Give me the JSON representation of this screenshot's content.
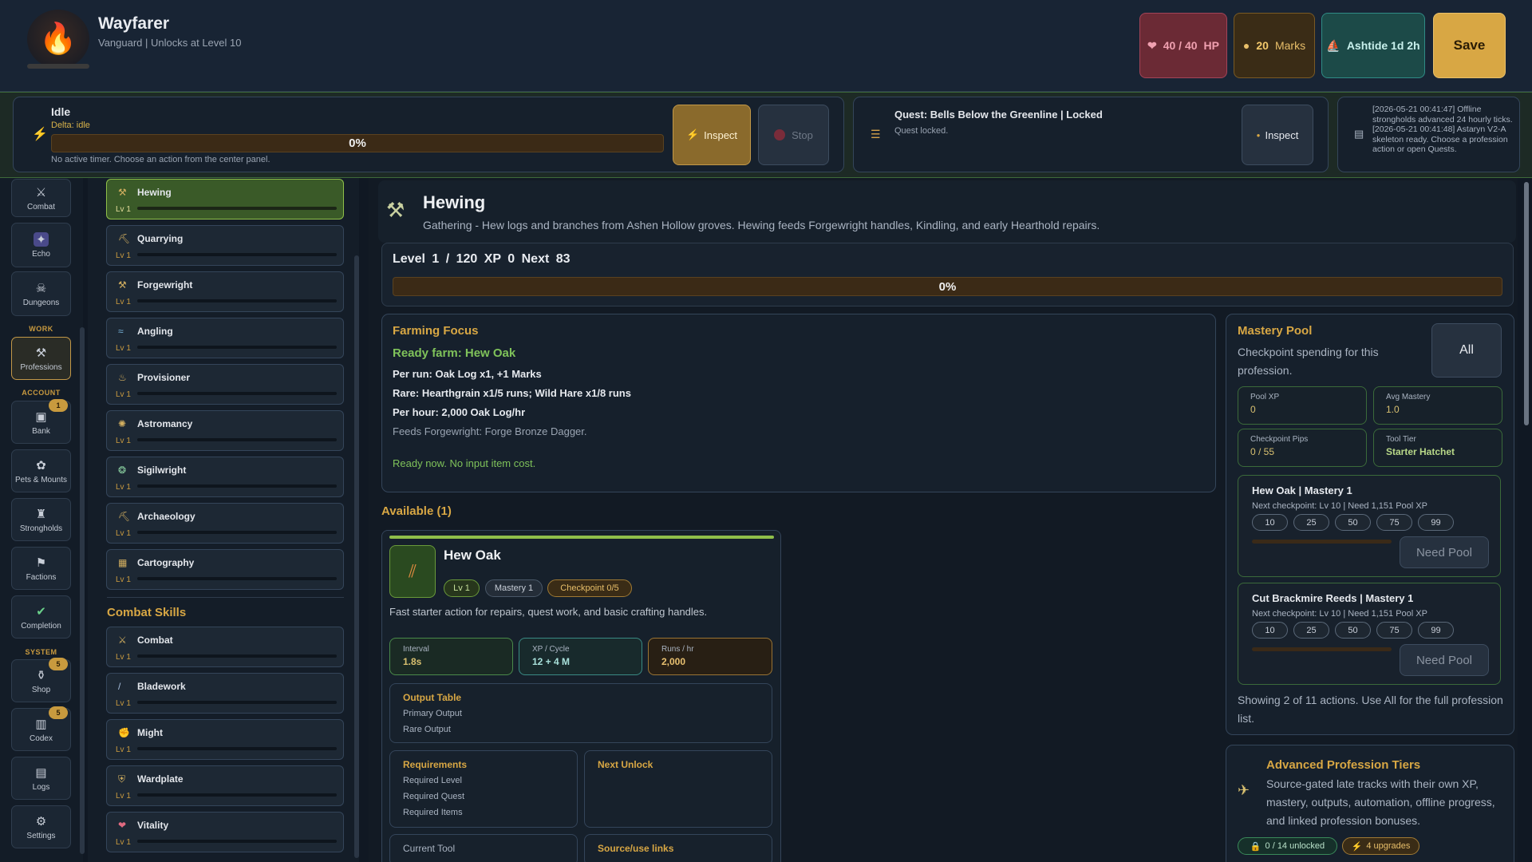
{
  "app": {
    "title": "Wayfarer",
    "subtitle": "Vanguard | Unlocks at Level 10",
    "logo_icon": "flame-icon"
  },
  "stats": {
    "hp_label": "40 / 40",
    "hp_suffix": "HP",
    "marks_value": "20",
    "marks_label": "Marks",
    "ashtide_label": "Ashtide 1d 2h"
  },
  "save_label": "Save",
  "activity": {
    "title": "Idle",
    "delta": "Delta: idle",
    "progress_label": "0%",
    "progress": 0,
    "note": "No active timer. Choose an action from the center panel.",
    "inspect_label": "Inspect",
    "stop_label": "Stop"
  },
  "quest": {
    "title": "Quest: Bells Below the Greenline | Locked",
    "status": "Quest locked.",
    "inspect_label": "Inspect"
  },
  "log": {
    "entries": [
      "[2026-05-21 00:41:47] Offline strongholds advanced 24 hourly ticks.",
      "[2026-05-21 00:41:48] Astaryn V2-A skeleton ready. Choose a profession action or open Quests."
    ]
  },
  "nav": {
    "sections": {
      "work": "WORK",
      "account": "ACCOUNT",
      "system": "SYSTEM"
    },
    "items": [
      {
        "label": "Combat",
        "icon": "crossed-swords-icon"
      },
      {
        "label": "Echo",
        "icon": "sparkle-icon"
      },
      {
        "label": "Dungeons",
        "icon": "skull-icon"
      },
      {
        "label": "Professions",
        "icon": "pickaxe-icon"
      },
      {
        "label": "Bank",
        "icon": "chest-icon",
        "badge": "1"
      },
      {
        "label": "Pets & Mounts",
        "icon": "paw-icon"
      },
      {
        "label": "Strongholds",
        "icon": "castle-icon"
      },
      {
        "label": "Factions",
        "icon": "flag-icon"
      },
      {
        "label": "Completion",
        "icon": "check-circle-icon"
      },
      {
        "label": "Shop",
        "icon": "bag-icon",
        "badge": "5"
      },
      {
        "label": "Codex",
        "icon": "book-icon",
        "badge": "5"
      },
      {
        "label": "Logs",
        "icon": "scroll-icon"
      },
      {
        "label": "Settings",
        "icon": "gear-icon"
      }
    ]
  },
  "skills": {
    "gathering": [
      {
        "name": "Hewing",
        "level": "Lv 1",
        "icon": "hatchet-icon"
      },
      {
        "name": "Quarrying",
        "level": "Lv 1",
        "icon": "pickaxe-icon"
      },
      {
        "name": "Forgewright",
        "level": "Lv 1",
        "icon": "hammer-icon"
      },
      {
        "name": "Angling",
        "level": "Lv 1",
        "icon": "fish-icon"
      },
      {
        "name": "Provisioner",
        "level": "Lv 1",
        "icon": "cooking-icon"
      },
      {
        "name": "Astromancy",
        "level": "Lv 1",
        "icon": "star-icon"
      },
      {
        "name": "Sigilwright",
        "level": "Lv 1",
        "icon": "rune-icon"
      },
      {
        "name": "Archaeology",
        "level": "Lv 1",
        "icon": "shovel-icon"
      },
      {
        "name": "Cartography",
        "level": "Lv 1",
        "icon": "map-icon"
      }
    ],
    "combat_title": "Combat Skills",
    "combat": [
      {
        "name": "Combat",
        "level": "Lv 1",
        "icon": "crossed-swords-icon"
      },
      {
        "name": "Bladework",
        "level": "Lv 1",
        "icon": "sword-icon"
      },
      {
        "name": "Might",
        "level": "Lv 1",
        "icon": "fist-icon"
      },
      {
        "name": "Wardplate",
        "level": "Lv 1",
        "icon": "shield-icon"
      },
      {
        "name": "Vitality",
        "level": "Lv 1",
        "icon": "heart-icon"
      }
    ]
  },
  "profession": {
    "name": "Hewing",
    "icon": "hatchet-icon",
    "description": "Gathering - Hew logs and branches from Ashen Hollow groves. Hewing feeds Forgewright handles, Kindling, and early Hearthold repairs.",
    "level_text": "Level 1 / 120",
    "xp_text": "XP 0",
    "next_text": "Next 83",
    "progress_label": "0%",
    "progress": 0
  },
  "farming": {
    "title": "Farming Focus",
    "ready": "Ready farm: Hew Oak",
    "per_run": "Per run: Oak Log x1, +1 Marks",
    "rare": "Rare: Hearthgrain x1/5 runs; Wild Hare x1/8 runs",
    "per_hour": "Per hour: 2,000 Oak Log/hr",
    "feeds": "Feeds Forgewright: Forge Bronze Dagger.",
    "ready_now": "Ready now. No input item cost."
  },
  "available_title": "Available (1)",
  "action_card": {
    "name": "Hew Oak",
    "icon": "logs-icon",
    "level_pill": "Lv 1",
    "mastery_pill": "Mastery 1",
    "checkpoint_pill": "Checkpoint 0/5",
    "description": "Fast starter action for repairs, quest work, and basic crafting handles.",
    "interval_label": "Interval",
    "interval_value": "1.8s",
    "xp_label": "XP / Cycle",
    "xp_value": "12 + 4 M",
    "runs_label": "Runs / hr",
    "runs_value": "2,000",
    "output_title": "Output Table",
    "primary_output": "Primary Output",
    "rare_output": "Rare Output",
    "req_title": "Requirements",
    "req_level": "Required Level",
    "req_quest": "Required Quest",
    "req_items": "Required Items",
    "next_unlock_title": "Next Unlock",
    "current_tool_title": "Current Tool",
    "source_title": "Source/use links"
  },
  "mastery": {
    "title": "Mastery Pool",
    "description": "Checkpoint spending for this profession.",
    "all_label": "All",
    "pool_xp_label": "Pool XP",
    "pool_xp_value": "0",
    "avg_label": "Avg Mastery",
    "avg_value": "1.0",
    "pips_label": "Checkpoint Pips",
    "pips_value": "0 / 55",
    "tool_label": "Tool Tier",
    "tool_value": "Starter Hatchet",
    "actions": [
      {
        "name": "Hew Oak | Mastery 1",
        "checkpoint": "Next checkpoint: Lv 10 | Need 1,151 Pool XP",
        "pips": [
          "10",
          "25",
          "50",
          "75",
          "99"
        ],
        "button": "Need Pool"
      },
      {
        "name": "Cut Brackmire Reeds | Mastery 1",
        "checkpoint": "Next checkpoint: Lv 10 | Need 1,151 Pool XP",
        "pips": [
          "10",
          "25",
          "50",
          "75",
          "99"
        ],
        "button": "Need Pool"
      }
    ],
    "footer": "Showing 2 of 11 actions. Use All for the full profession list."
  },
  "advanced": {
    "title": "Advanced Profession Tiers",
    "description": "Source-gated late tracks with their own XP, mastery, outputs, automation, offline progress, and linked profession bonuses.",
    "icon": "trophy-icon",
    "unlocked_pill": "0 / 14 unlocked",
    "upgrades_pill": "4 upgrades"
  },
  "colors": {
    "accent": "#d8a744",
    "success": "#7fc25a",
    "background": "#101823"
  }
}
